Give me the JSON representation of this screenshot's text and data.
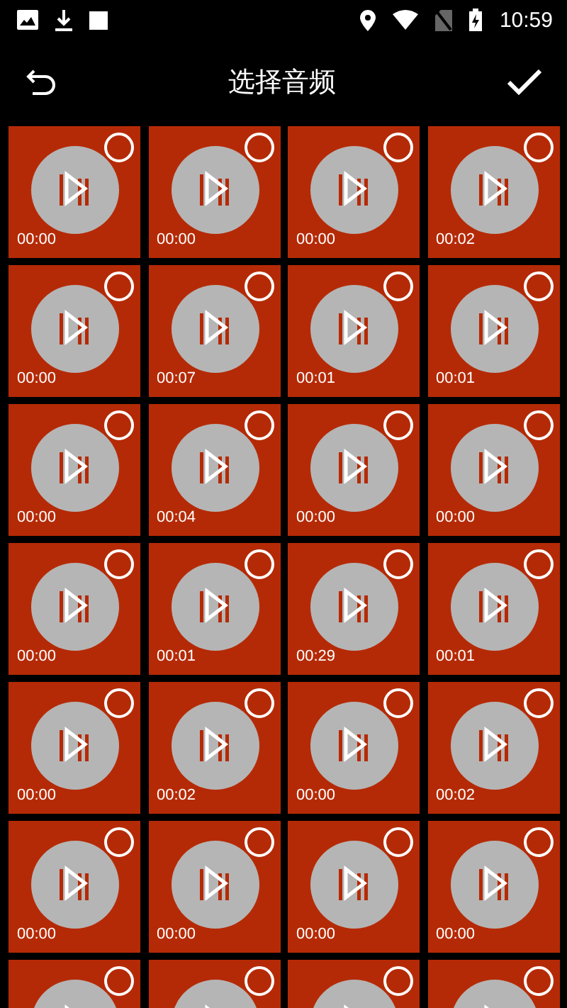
{
  "status_bar": {
    "time": "10:59"
  },
  "app_bar": {
    "title": "选择音频"
  },
  "tiles": [
    {
      "duration": "00:00",
      "selected": false
    },
    {
      "duration": "00:00",
      "selected": false
    },
    {
      "duration": "00:00",
      "selected": false
    },
    {
      "duration": "00:02",
      "selected": false
    },
    {
      "duration": "00:00",
      "selected": false
    },
    {
      "duration": "00:07",
      "selected": false
    },
    {
      "duration": "00:01",
      "selected": false
    },
    {
      "duration": "00:01",
      "selected": false
    },
    {
      "duration": "00:00",
      "selected": false
    },
    {
      "duration": "00:04",
      "selected": false
    },
    {
      "duration": "00:00",
      "selected": false
    },
    {
      "duration": "00:00",
      "selected": false
    },
    {
      "duration": "00:00",
      "selected": false
    },
    {
      "duration": "00:01",
      "selected": false
    },
    {
      "duration": "00:29",
      "selected": false
    },
    {
      "duration": "00:01",
      "selected": false
    },
    {
      "duration": "00:00",
      "selected": false
    },
    {
      "duration": "00:02",
      "selected": false
    },
    {
      "duration": "00:00",
      "selected": false
    },
    {
      "duration": "00:02",
      "selected": false
    },
    {
      "duration": "00:00",
      "selected": false
    },
    {
      "duration": "00:00",
      "selected": false
    },
    {
      "duration": "00:00",
      "selected": false
    },
    {
      "duration": "00:00",
      "selected": false
    },
    {
      "selected": false
    },
    {
      "selected": false
    },
    {
      "selected": false
    },
    {
      "selected": false
    }
  ]
}
